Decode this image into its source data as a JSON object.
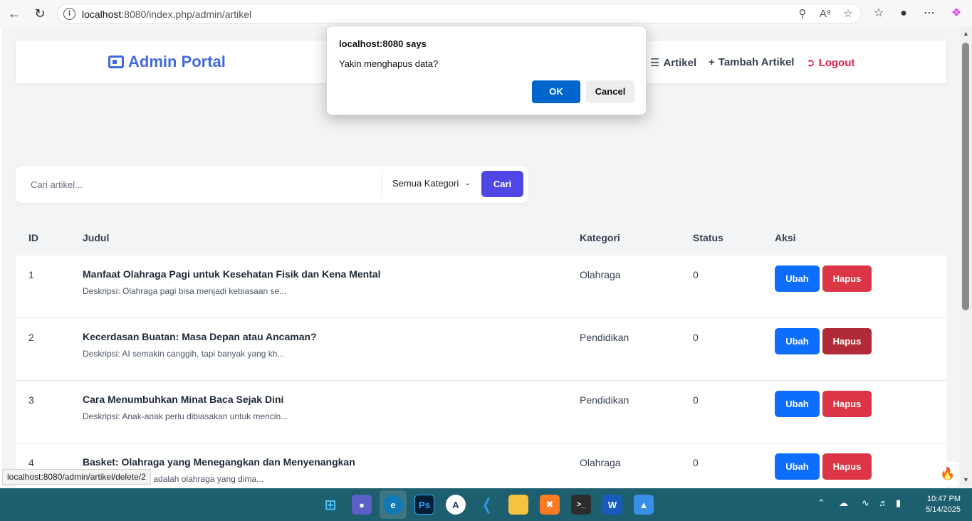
{
  "browser": {
    "url_host": "localhost",
    "url_rest": ":8080/index.php/admin/artikel",
    "status_link": "localhost:8080/admin/artikel/delete/2"
  },
  "header": {
    "brand": "Admin Portal",
    "nav": [
      {
        "label": "Artikel"
      },
      {
        "label": "Tambah Artikel"
      },
      {
        "label": "Logout"
      }
    ]
  },
  "search": {
    "placeholder": "Cari artikel...",
    "category": "Semua Kategori",
    "button": "Cari"
  },
  "table": {
    "headers": {
      "id": "ID",
      "judul": "Judul",
      "kategori": "Kategori",
      "status": "Status",
      "aksi": "Aksi"
    },
    "rows": [
      {
        "id": "1",
        "title": "Manfaat Olahraga Pagi untuk Kesehatan Fisik dan Kena Mental",
        "desc": "Deskripsi: Olahraga pagi bisa menjadi kebiasaan se...",
        "category": "Olahraga",
        "status": "0"
      },
      {
        "id": "2",
        "title": "Kecerdasan Buatan: Masa Depan atau Ancaman?",
        "desc": "Deskripsi: AI semakin canggih, tapi banyak yang kh...",
        "category": "Pendidikan",
        "status": "0"
      },
      {
        "id": "3",
        "title": "Cara Menumbuhkan Minat Baca Sejak Dini",
        "desc": "Deskripsi: Anak-anak perlu dibiasakan untuk mencin...",
        "category": "Pendidikan",
        "status": "0"
      },
      {
        "id": "4",
        "title": "Basket: Olahraga yang Menegangkan dan Menyenangkan",
        "desc": "Deskripsi: Basket, adalah olahraga yang dima...",
        "category": "Olahraga",
        "status": "0"
      }
    ],
    "edit_label": "Ubah",
    "delete_label": "Hapus"
  },
  "dialog": {
    "title": "localhost:8080 says",
    "message": "Yakin menghapus data?",
    "ok": "OK",
    "cancel": "Cancel"
  },
  "taskbar": {
    "time": "10:47 PM",
    "date": "5/14/2025"
  },
  "colors": {
    "brand": "#4169e1",
    "primary_button": "#4f46e5",
    "edit_button": "#0d6efd",
    "delete_button": "#dc3545",
    "logout": "#e11d48",
    "dialog_ok": "#0066cc"
  },
  "icons": [
    "back-arrow-icon",
    "refresh-icon",
    "info-icon",
    "zoom-icon",
    "read-aloud-icon",
    "favorite-star-icon",
    "favorites-icon",
    "profile-icon",
    "more-icon",
    "copilot-icon",
    "newspaper-icon",
    "list-icon",
    "plus-icon",
    "logout-icon",
    "chevron-down-icon",
    "fire-icon"
  ]
}
